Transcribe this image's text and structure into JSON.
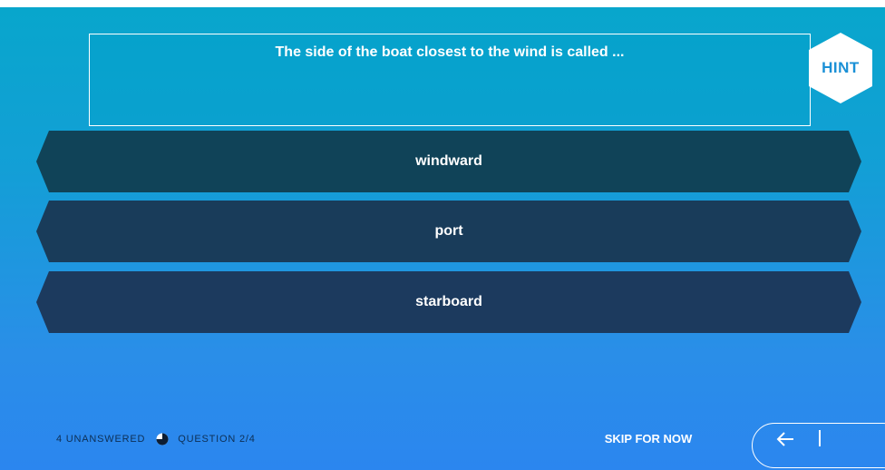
{
  "question": {
    "text": "The side of the boat closest to the wind is called ..."
  },
  "hint": {
    "label": "HINT"
  },
  "answers": [
    {
      "label": "windward",
      "color": "#104358"
    },
    {
      "label": "port",
      "color": "#193c5a"
    },
    {
      "label": "starboard",
      "color": "#1c3a5e"
    }
  ],
  "footer": {
    "unanswered": "4 UNANSWERED",
    "progress_icon": "pie-progress-icon",
    "question_counter": "QUESTION 2/4",
    "skip_label": "SKIP FOR NOW",
    "back_icon": "arrow-left-icon"
  },
  "colors": {
    "gradient_top": "#08a6cc",
    "gradient_bottom": "#2b86ef",
    "footer_text": "#0d2f55",
    "hint_text": "#1a90d6"
  }
}
